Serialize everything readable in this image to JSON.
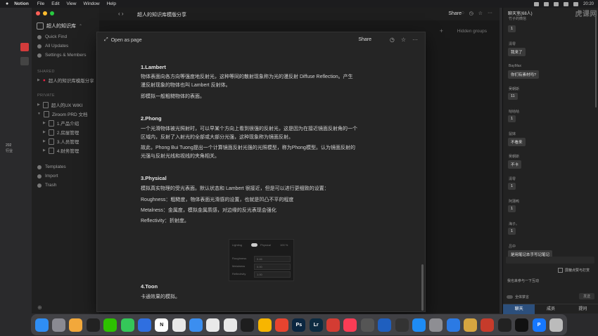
{
  "menubar": {
    "apple": "",
    "app": "Notion",
    "items": [
      "File",
      "Edit",
      "View",
      "Window",
      "Help"
    ],
    "clock": "20:20"
  },
  "notion": {
    "workspace": "超人的知识库",
    "sidebar": {
      "quick_find": "Quick Find",
      "all_updates": "All Updates",
      "settings": "Settings & Members",
      "shared_head": "SHARED",
      "shared_page": "超人的知识库模版分享",
      "private_head": "PRIVATE",
      "private_page": "超人的UX WIKI",
      "prd": "Ziroom PRD 文档",
      "sub": [
        "1.产品介绍",
        "2.房屋管理",
        "3.人员管理",
        "4.财务管理"
      ],
      "templates": "Templates",
      "import": "Import",
      "trash": "Trash"
    },
    "topbar": {
      "title": "超人的知识库模版分享",
      "share": "Share"
    },
    "board": {
      "hidden_groups": "Hidden groups"
    },
    "peek": {
      "open_as_page": "Open as page",
      "share": "Share",
      "sections": {
        "lambert": {
          "title": "1.Lambert",
          "l1": "物体表面向各方向等强度地反射光，这种等同的散射现象称为光的漫反射 Diffuse Reflection。产生",
          "l2": "漫反射现象的物体也叫 Lambert 反射体。",
          "l3": "即模拟一般粗糙物体的表面。"
        },
        "phong": {
          "title": "2.Phong",
          "l1": "一个光滑物体被光照射时，可以早某个方向上看到很强的反射光，这是因为在接近镜面反射角的一个",
          "l2": "区域内，反射了入射光的全部或大部分光强，这种现象称为镜面反射。",
          "l3": "故此，Phong Bui Tuong提出一个计算镜面反射光强的光照模型，称为Phong模型。认为镜面反射的",
          "l4": "光强与反射光线和视线的夹角相关。"
        },
        "physical": {
          "title": "3.Physical",
          "l1": "模拟真实物理的受光表面。默认状态和 Lambert 很接近，但是可以进行更细致的设置：",
          "l2": "Roughness：粗糙度，物体表面光滑感的设置，也就是凹凸不平的程度",
          "l3": "Metalness：金属度，模拟金属质感，对边缘的反光表现会强化",
          "l4": "Reflectivity：折射度。"
        },
        "toon": {
          "title": "4.Toon",
          "l1": "卡通效果的模拟。"
        }
      },
      "material": {
        "lighting": "Lighting",
        "physical": "Physical",
        "percent": "100 %",
        "roughness": "Roughness",
        "roughness_val": "0.46",
        "metalness": "Metalness",
        "metalness_val": "0.00",
        "reflectivity": "Reflectivity",
        "reflectivity_val": "1.00"
      }
    }
  },
  "chat": {
    "title": "聊天室(68人)",
    "watermark": "虎课网",
    "first": "竹子的微信",
    "messages": [
      {
        "name": "",
        "text": "1"
      },
      {
        "name": "清零",
        "text": "我来了"
      },
      {
        "name": "BayMax",
        "text": "你们有素材吗?"
      },
      {
        "name": "吴朝斯",
        "text": "11"
      },
      {
        "name": "咕咕咕",
        "text": "1"
      },
      {
        "name": "鼠妹",
        "text": "不看来"
      },
      {
        "name": "吴朝斯",
        "text": "不卡"
      },
      {
        "name": "清零",
        "text": "1"
      },
      {
        "name": "阿蒲鸭",
        "text": "1"
      },
      {
        "name": "海子。",
        "text": "1"
      },
      {
        "name": "吕中",
        "text": "是用笔记本手写记笔记"
      }
    ],
    "block_label": "屏蔽点赞与打赏",
    "hint": "我也来参与一下互动",
    "mute": "全体禁言",
    "send": "发送",
    "tabs": [
      "聊天",
      "成员",
      "提问"
    ]
  },
  "desktop": {
    "y1": "202",
    "y2": "行业"
  },
  "dock": {
    "apps": [
      {
        "name": "finder",
        "label": "",
        "color": "#2f8ef4"
      },
      {
        "name": "launchpad",
        "label": "",
        "color": "#8a8a92"
      },
      {
        "name": "photos",
        "label": "",
        "color": "#f2a83b"
      },
      {
        "name": "qq",
        "label": "",
        "color": "#222"
      },
      {
        "name": "wechat",
        "label": "",
        "color": "#2dc100"
      },
      {
        "name": "messages",
        "label": "",
        "color": "#34c759"
      },
      {
        "name": "tasks",
        "label": "",
        "color": "#2f6fe0"
      },
      {
        "name": "notion",
        "label": "N",
        "color": "#ffffff"
      },
      {
        "name": "pen",
        "label": "",
        "color": "#e8e8e8"
      },
      {
        "name": "safari",
        "label": "",
        "color": "#3b8ef0"
      },
      {
        "name": "chrome",
        "label": "",
        "color": "#e9e9e9"
      },
      {
        "name": "xd",
        "label": "",
        "color": "#e8e8e8"
      },
      {
        "name": "figma",
        "label": "",
        "color": "#1e1e1e"
      },
      {
        "name": "sketch",
        "label": "",
        "color": "#f7b500"
      },
      {
        "name": "app-red",
        "label": "",
        "color": "#e8442f"
      },
      {
        "name": "photoshop",
        "label": "Ps",
        "color": "#0b2640"
      },
      {
        "name": "lightroom",
        "label": "Lr",
        "color": "#0c2b40"
      },
      {
        "name": "netease-music",
        "label": "",
        "color": "#d43c33"
      },
      {
        "name": "music",
        "label": "",
        "color": "#fa3c55"
      },
      {
        "name": "app-clock",
        "label": "",
        "color": "#555"
      },
      {
        "name": "app-circle",
        "label": "",
        "color": "#1f5fbf"
      },
      {
        "name": "obs",
        "label": "",
        "color": "#333"
      },
      {
        "name": "app-store",
        "label": "",
        "color": "#1e8cf5"
      },
      {
        "name": "settings",
        "label": "",
        "color": "#8e8e93"
      },
      {
        "name": "app-blue",
        "label": "",
        "color": "#2b7ae4"
      },
      {
        "name": "app-yellow",
        "label": "",
        "color": "#d6a640"
      },
      {
        "name": "app-logo",
        "label": "",
        "color": "#c63b2b"
      },
      {
        "name": "qq2",
        "label": "",
        "color": "#222"
      },
      {
        "name": "terminal",
        "label": "",
        "color": "#111"
      },
      {
        "name": "pay",
        "label": "P",
        "color": "#1677ff"
      },
      {
        "name": "trash",
        "label": "",
        "color": "#bbb"
      }
    ]
  },
  "colors": {
    "chat_tab_active": "#2c4f7c",
    "traffic_red": "#ff5f57",
    "traffic_yellow": "#febc2e",
    "traffic_green": "#28c840"
  }
}
